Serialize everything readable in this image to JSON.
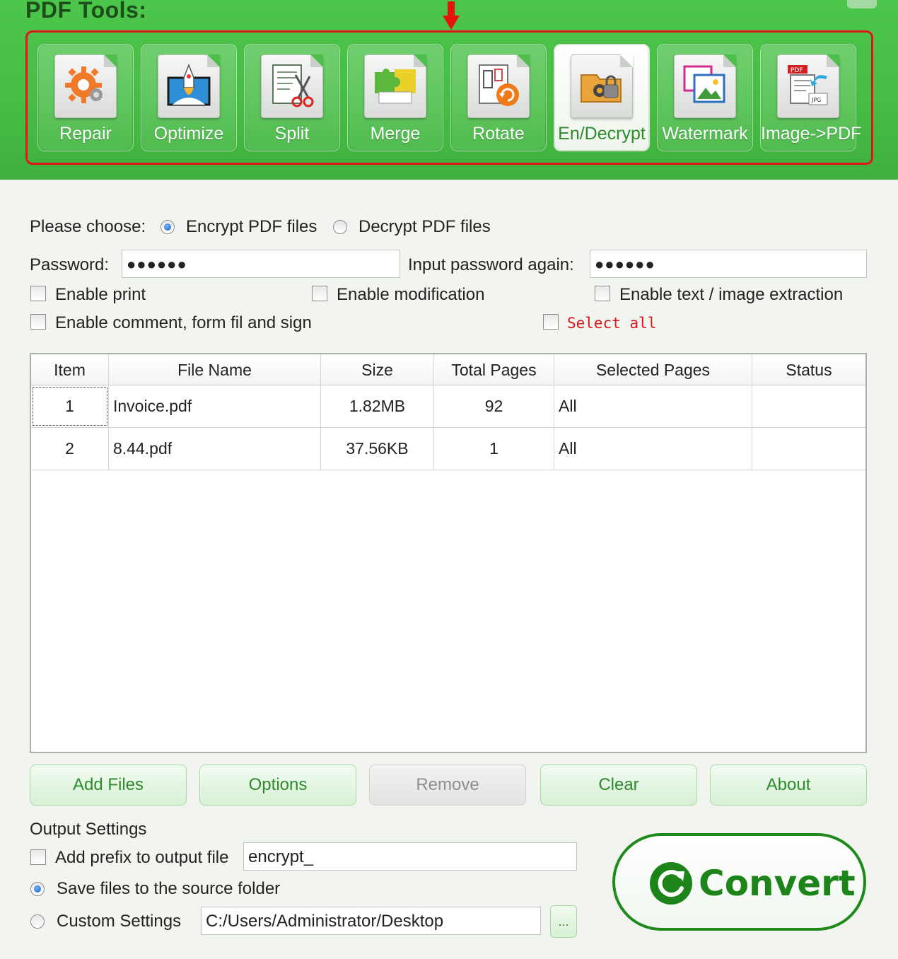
{
  "header": {
    "title": "PDF Tools:",
    "tools": [
      {
        "label": "Repair",
        "icon": "repair-gear-icon",
        "active": false
      },
      {
        "label": "Optimize",
        "icon": "optimize-rocket-icon",
        "active": false
      },
      {
        "label": "Split",
        "icon": "split-scissors-icon",
        "active": false
      },
      {
        "label": "Merge",
        "icon": "merge-puzzle-icon",
        "active": false
      },
      {
        "label": "Rotate",
        "icon": "rotate-icon",
        "active": false
      },
      {
        "label": "En/Decrypt",
        "icon": "encrypt-lock-icon",
        "active": true
      },
      {
        "label": "Watermark",
        "icon": "watermark-icon",
        "active": false
      },
      {
        "label": "Image->PDF",
        "icon": "image-to-pdf-icon",
        "active": false
      }
    ],
    "colors": {
      "brand_green": "#46bd44",
      "highlight_red": "#e3141b"
    }
  },
  "encrypt": {
    "choose_label": "Please choose:",
    "option_encrypt": "Encrypt PDF files",
    "option_decrypt": "Decrypt PDF files",
    "selected_option": "encrypt",
    "password_label": "Password:",
    "password_value": "●●●●●●",
    "password_again_label": "Input password again:",
    "password_again_value": "●●●●●●",
    "permissions": {
      "enable_print": "Enable print",
      "enable_modification": "Enable modification",
      "enable_extraction": "Enable text / image extraction",
      "enable_comment": "Enable comment, form fil and sign",
      "select_all": "Select all"
    }
  },
  "table": {
    "columns": [
      "Item",
      "File Name",
      "Size",
      "Total Pages",
      "Selected Pages",
      "Status"
    ],
    "rows": [
      {
        "item": "1",
        "file_name": "Invoice.pdf",
        "size": "1.82MB",
        "total_pages": "92",
        "selected_pages": "All",
        "status": ""
      },
      {
        "item": "2",
        "file_name": "8.44.pdf",
        "size": "37.56KB",
        "total_pages": "1",
        "selected_pages": "All",
        "status": ""
      }
    ]
  },
  "buttons": {
    "add_files": "Add Files",
    "options": "Options",
    "remove": "Remove",
    "clear": "Clear",
    "about": "About",
    "browse": "...",
    "convert": "Convert"
  },
  "output": {
    "section_label": "Output Settings",
    "add_prefix_label": "Add prefix to output file",
    "prefix_value": "encrypt_",
    "save_source_label": "Save files to the source folder",
    "custom_label": "Custom Settings",
    "custom_path": "C:/Users/Administrator/Desktop",
    "selected_output": "source"
  }
}
